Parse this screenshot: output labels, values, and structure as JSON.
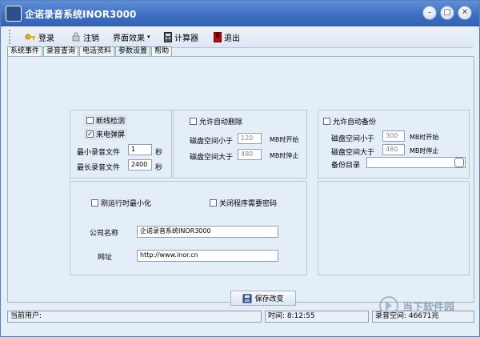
{
  "window": {
    "title": "企诺录音系统INOR3000",
    "controls": [
      "minimize",
      "maximize",
      "close"
    ]
  },
  "toolbar": {
    "items": [
      {
        "label": "登录",
        "icon": "key-icon"
      },
      {
        "label": "注销",
        "icon": "lock-icon"
      },
      {
        "label": "界面效果",
        "icon": "dropdown-arrow-icon"
      },
      {
        "label": "计算器",
        "icon": "calculator-icon"
      },
      {
        "label": "退出",
        "icon": "exit-icon"
      }
    ]
  },
  "tabs": [
    "系统事件",
    "录音查询",
    "电话资料",
    "参数设置",
    "帮助"
  ],
  "active_tab": "参数设置",
  "line_panel": {
    "disconnect_detect": {
      "label": "断线检测",
      "checked": false
    },
    "power_popup": {
      "label": "来电弹屏",
      "checked": true
    },
    "min_file_label": "最小录音文件",
    "min_file_value": "1",
    "max_file_label": "最长录音文件",
    "max_file_value": "2400",
    "unit_seconds": "秒"
  },
  "auto_delete": {
    "label": "允许自动删除",
    "checked": false,
    "low_label": "磁盘空间小于",
    "low_value": "120",
    "low_suffix": "MB时开始",
    "high_label": "磁盘空间大于",
    "high_value": "480",
    "high_suffix": "MB时停止"
  },
  "auto_backup": {
    "label": "允许自动备份",
    "checked": false,
    "low_label": "磁盘空间小于",
    "low_value": "300",
    "low_suffix": "MB时开始",
    "high_label": "磁盘空间大于",
    "high_value": "480",
    "high_suffix": "MB时停止",
    "dir_label": "备份目录",
    "dir_value": ""
  },
  "general": {
    "minimize_on_run": {
      "label": "刚运行时最小化",
      "checked": false
    },
    "password_on_close": {
      "label": "关闭程序需要密码",
      "checked": false
    },
    "company_label": "公司名称",
    "company_value": "企诺录音系统INOR3000",
    "website_label": "网址",
    "website_value": "http://www.inor.cn"
  },
  "save_button": {
    "label": "保存改变"
  },
  "statusbar": {
    "user": "当前用户:",
    "time": "时间: 8:12:55",
    "space": "录音空间: 46671兆"
  },
  "watermark": {
    "line1": "当下软件园",
    "line2": ""
  },
  "colors": {
    "title_bar": "#3c6cc0",
    "window_bg": "#e4eef8",
    "panel_border": "#b9c6d6"
  }
}
